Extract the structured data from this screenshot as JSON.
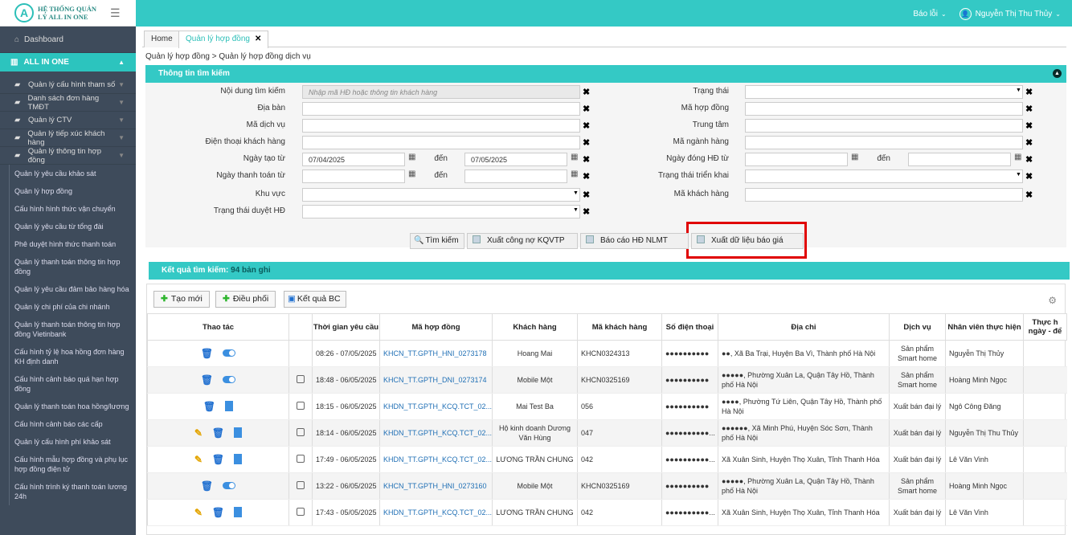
{
  "app": {
    "logo_letter": "A",
    "logo_text": "HỆ THỐNG QUẢN LÝ ALL IN ONE"
  },
  "header": {
    "report": "Báo lỗi",
    "user": "Nguyễn Thị Thu Thủy"
  },
  "sidebar": {
    "dashboard": "Dashboard",
    "active": "ALL IN ONE",
    "groups": [
      "Quản lý cấu hình tham số",
      "Danh sách đơn hàng TMĐT",
      "Quản lý CTV",
      "Quản lý tiếp xúc khách hàng",
      "Quản lý thông tin hợp đồng"
    ],
    "subs": [
      "Quản lý yêu cầu khảo sát",
      "Quản lý hợp đồng",
      "Cấu hình hình thức vận chuyển",
      "Quản lý yêu cầu từ tổng đài",
      "Phê duyệt hình thức thanh toán",
      "Quản lý thanh toán thông tin hợp đồng",
      "Quản lý yêu cầu đảm bảo hàng hóa",
      "Quản lý chi phí của chi nhánh",
      "Quản lý thanh toán thông tin hợp đồng Vietinbank",
      "Cấu hình tỷ lệ hoa hồng đơn hàng KH định danh",
      "Cấu hình cảnh báo quá hạn hợp đồng",
      "Quản lý thanh toán hoa hồng/lương",
      "Cấu hình cảnh báo các cấp",
      "Quản lý cấu hình phí khảo sát",
      "Cấu hình mẫu hợp đồng và phụ lục hợp đồng điện tử",
      "Cấu hình trình ký thanh toán lương 24h"
    ]
  },
  "tabs": [
    "Home",
    "Quản lý hợp đồng"
  ],
  "breadcrumb": "Quản lý hợp đồng > Quản lý hợp đồng dịch vụ",
  "search": {
    "title": "Thông tin tìm kiếm",
    "keyword_label": "Nội dung tìm kiếm",
    "keyword_placeholder": "Nhập mã HĐ hoặc thông tin khách hàng",
    "area_label": "Địa bàn",
    "service_label": "Mã dịch vụ",
    "phone_label": "Điện thoại khách hàng",
    "created_label": "Ngày tạo từ",
    "to": "đến",
    "created_from": "07/04/2025",
    "created_to": "07/05/2025",
    "paid_label": "Ngày thanh toán từ",
    "region_label": "Khu vực",
    "approve_label": "Trạng thái duyệt HĐ",
    "status_label": "Trạng thái",
    "contract_code_label": "Mã hợp đồng",
    "center_label": "Trung tâm",
    "industry_label": "Mã ngành hàng",
    "close_label": "Ngày đóng HĐ từ",
    "deploy_label": "Trạng thái triển khai",
    "customer_code_label": "Mã khách hàng",
    "btn_search": "Tìm kiếm",
    "btn_debt": "Xuất công nợ KQVTP",
    "btn_report": "Báo cáo HĐ NLMT",
    "btn_export": "Xuất dữ liệu báo giá"
  },
  "results": {
    "title": "Kết quả tìm kiếm:",
    "count": "94",
    "unit": "bản ghi",
    "btn_new": "Tạo mới",
    "btn_dispatch": "Điều phối",
    "btn_bc": "Kết quả BC",
    "columns": [
      "Thao tác",
      "",
      "Thời gian yêu cầu",
      "Mã hợp đồng",
      "Khách hàng",
      "Mã khách hàng",
      "Số điện thoại",
      "Địa chỉ",
      "Dịch vụ",
      "Nhân viên thực hiện",
      "Thực h ngày - để"
    ],
    "rows": [
      {
        "time": "08:26 - 07/05/2025",
        "code": "KHCN_TT.GPTH_HNI_0273178",
        "customer": "Hoang Mai",
        "cust_code": "KHCN0324313",
        "phone": "●●●●●●●●●●",
        "address": "●●, Xã Ba Trại, Huyện Ba Vì, Thành phố Hà Nội",
        "service": "Sản phẩm Smart home",
        "staff": "Nguyễn Thị Thủy"
      },
      {
        "time": "18:48 - 06/05/2025",
        "code": "KHCN_TT.GPTH_DNI_0273174",
        "customer": "Mobile Một",
        "cust_code": "KHCN0325169",
        "phone": "●●●●●●●●●●",
        "address": "●●●●●, Phường Xuân La, Quận Tây Hồ, Thành phố Hà Nội",
        "service": "Sản phẩm Smart home",
        "staff": "Hoàng Minh Ngọc"
      },
      {
        "time": "18:15 - 06/05/2025",
        "code": "KHDN_TT.GPTH_KCQ.TCT_02...",
        "customer": "Mai Test Ba",
        "cust_code": "056",
        "phone": "●●●●●●●●●●",
        "address": "●●●●, Phường Tứ Liên, Quận Tây Hồ, Thành phố Hà Nội",
        "service": "Xuất bán đại lý",
        "staff": "Ngô Công Đăng"
      },
      {
        "time": "18:14 - 06/05/2025",
        "code": "KHDN_TT.GPTH_KCQ.TCT_02...",
        "customer": "Hộ kinh doanh Dương Văn Hùng",
        "cust_code": "047",
        "phone": "●●●●●●●●●●...",
        "address": "●●●●●●, Xã Minh Phú, Huyện Sóc Sơn, Thành phố Hà Nội",
        "service": "Xuất bán đại lý",
        "staff": "Nguyễn Thị Thu Thủy"
      },
      {
        "time": "17:49 - 06/05/2025",
        "code": "KHDN_TT.GPTH_KCQ.TCT_02...",
        "customer": "LƯƠNG TRẦN CHUNG",
        "cust_code": "042",
        "phone": "●●●●●●●●●●...",
        "address": "Xã Xuân Sinh, Huyện Thọ Xuân, Tỉnh Thanh Hóa",
        "service": "Xuất bán đại lý",
        "staff": "Lê Văn Vinh"
      },
      {
        "time": "13:22 - 06/05/2025",
        "code": "KHCN_TT.GPTH_HNI_0273160",
        "customer": "Mobile Một",
        "cust_code": "KHCN0325169",
        "phone": "●●●●●●●●●●",
        "address": "●●●●●, Phường Xuân La, Quận Tây Hồ, Thành phố Hà Nội",
        "service": "Sản phẩm Smart home",
        "staff": "Hoàng Minh Ngọc"
      },
      {
        "time": "17:43 - 05/05/2025",
        "code": "KHDN_TT.GPTH_KCQ.TCT_02...",
        "customer": "LƯƠNG TRẦN CHUNG",
        "cust_code": "042",
        "phone": "●●●●●●●●●●...",
        "address": "Xã Xuân Sinh, Huyện Thọ Xuân, Tỉnh Thanh Hóa",
        "service": "Xuất bán đại lý",
        "staff": "Lê Văn Vinh"
      }
    ]
  }
}
